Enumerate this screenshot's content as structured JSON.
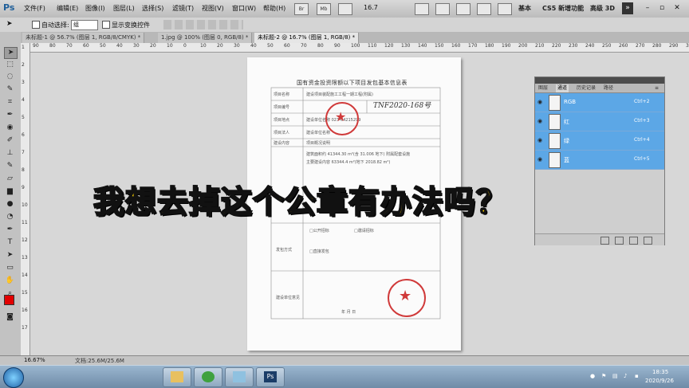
{
  "app": {
    "logo": "Ps"
  },
  "menu": [
    "文件(F)",
    "编辑(E)",
    "图像(I)",
    "图层(L)",
    "选择(S)",
    "滤镜(T)",
    "视图(V)",
    "窗口(W)",
    "帮助(H)"
  ],
  "menu_icons": [
    "Br",
    "Mb",
    "tool-icon",
    "hand-icon",
    "zoom-icon",
    "rotate-icon"
  ],
  "zoom_menu": "16.7",
  "workspaces": [
    "基本",
    "CS5 新增功能",
    "高级 3D"
  ],
  "options": {
    "auto_select_label": "自动选择:",
    "auto_select_value": "组",
    "transform_label": "显示变换控件"
  },
  "tabs": [
    "未标题-1 @ 56.7% (图层 1, RGB/8/CMYK) *",
    "1.jpg @ 100% (图层 0, RGB/8) *",
    "未标题-2 @ 16.7% (图层 1, RGB/8) *"
  ],
  "ruler_h": [
    "90",
    "80",
    "70",
    "60",
    "50",
    "40",
    "30",
    "20",
    "10",
    "0",
    "10",
    "20",
    "30",
    "40",
    "50",
    "60",
    "70",
    "80",
    "90",
    "100",
    "110",
    "120",
    "130",
    "140",
    "150",
    "160",
    "170",
    "180",
    "190",
    "200",
    "210",
    "220",
    "230",
    "240",
    "250",
    "260",
    "270",
    "280",
    "290",
    "300"
  ],
  "ruler_v": [
    "1",
    "2",
    "3",
    "4",
    "5",
    "6",
    "7",
    "8",
    "9",
    "10",
    "11",
    "12",
    "13",
    "14",
    "15",
    "16",
    "17"
  ],
  "document": {
    "title": "国有资金投资限额以下项目发包基本信息表",
    "rows": [
      {
        "label": "项目名称",
        "value": "建设项目装配施工工程一期工程(附属)"
      },
      {
        "label": "项目编号",
        "value": "TNF2020-168号"
      },
      {
        "label": "项目地点",
        "value": "建设单位名称    023-64215299"
      },
      {
        "label": "项目法人",
        "value": "建设单位名称"
      },
      {
        "label": "建设内容",
        "value": "项目概况说明"
      }
    ],
    "handwriting": "TNF2020-168号",
    "notes": [
      "建筑面积约 41344.30 m²(含 31.006 地下) 附属配套设施",
      "主要建设内容 63344.4 m²(地下 2018.82 m²)",
      "发包方式",
      "□公开招标",
      "□邀请招标",
      "□直接发包",
      "建设单位意见",
      "年 月 日"
    ]
  },
  "caption": "我想去掉这个公章有办法吗？",
  "panel": {
    "tabs": [
      "图层",
      "通道",
      "历史记录",
      "路径"
    ],
    "active_tab": 1,
    "channels": [
      {
        "name": "RGB",
        "shortcut": "Ctrl+2"
      },
      {
        "name": "红",
        "shortcut": "Ctrl+3"
      },
      {
        "name": "绿",
        "shortcut": "Ctrl+4"
      },
      {
        "name": "蓝",
        "shortcut": "Ctrl+5"
      }
    ]
  },
  "status": {
    "zoom": "16.67%",
    "doc": "文档:25.6M/25.6M"
  },
  "taskbar": {
    "apps": [
      "explorer",
      "ie",
      "media",
      "Ps"
    ],
    "time": "18:35",
    "date": "2020/9/26"
  },
  "colors": {
    "stamp": "#d03a3a",
    "caption": "#ffd400",
    "channel_selected": "#5ca7e6"
  }
}
